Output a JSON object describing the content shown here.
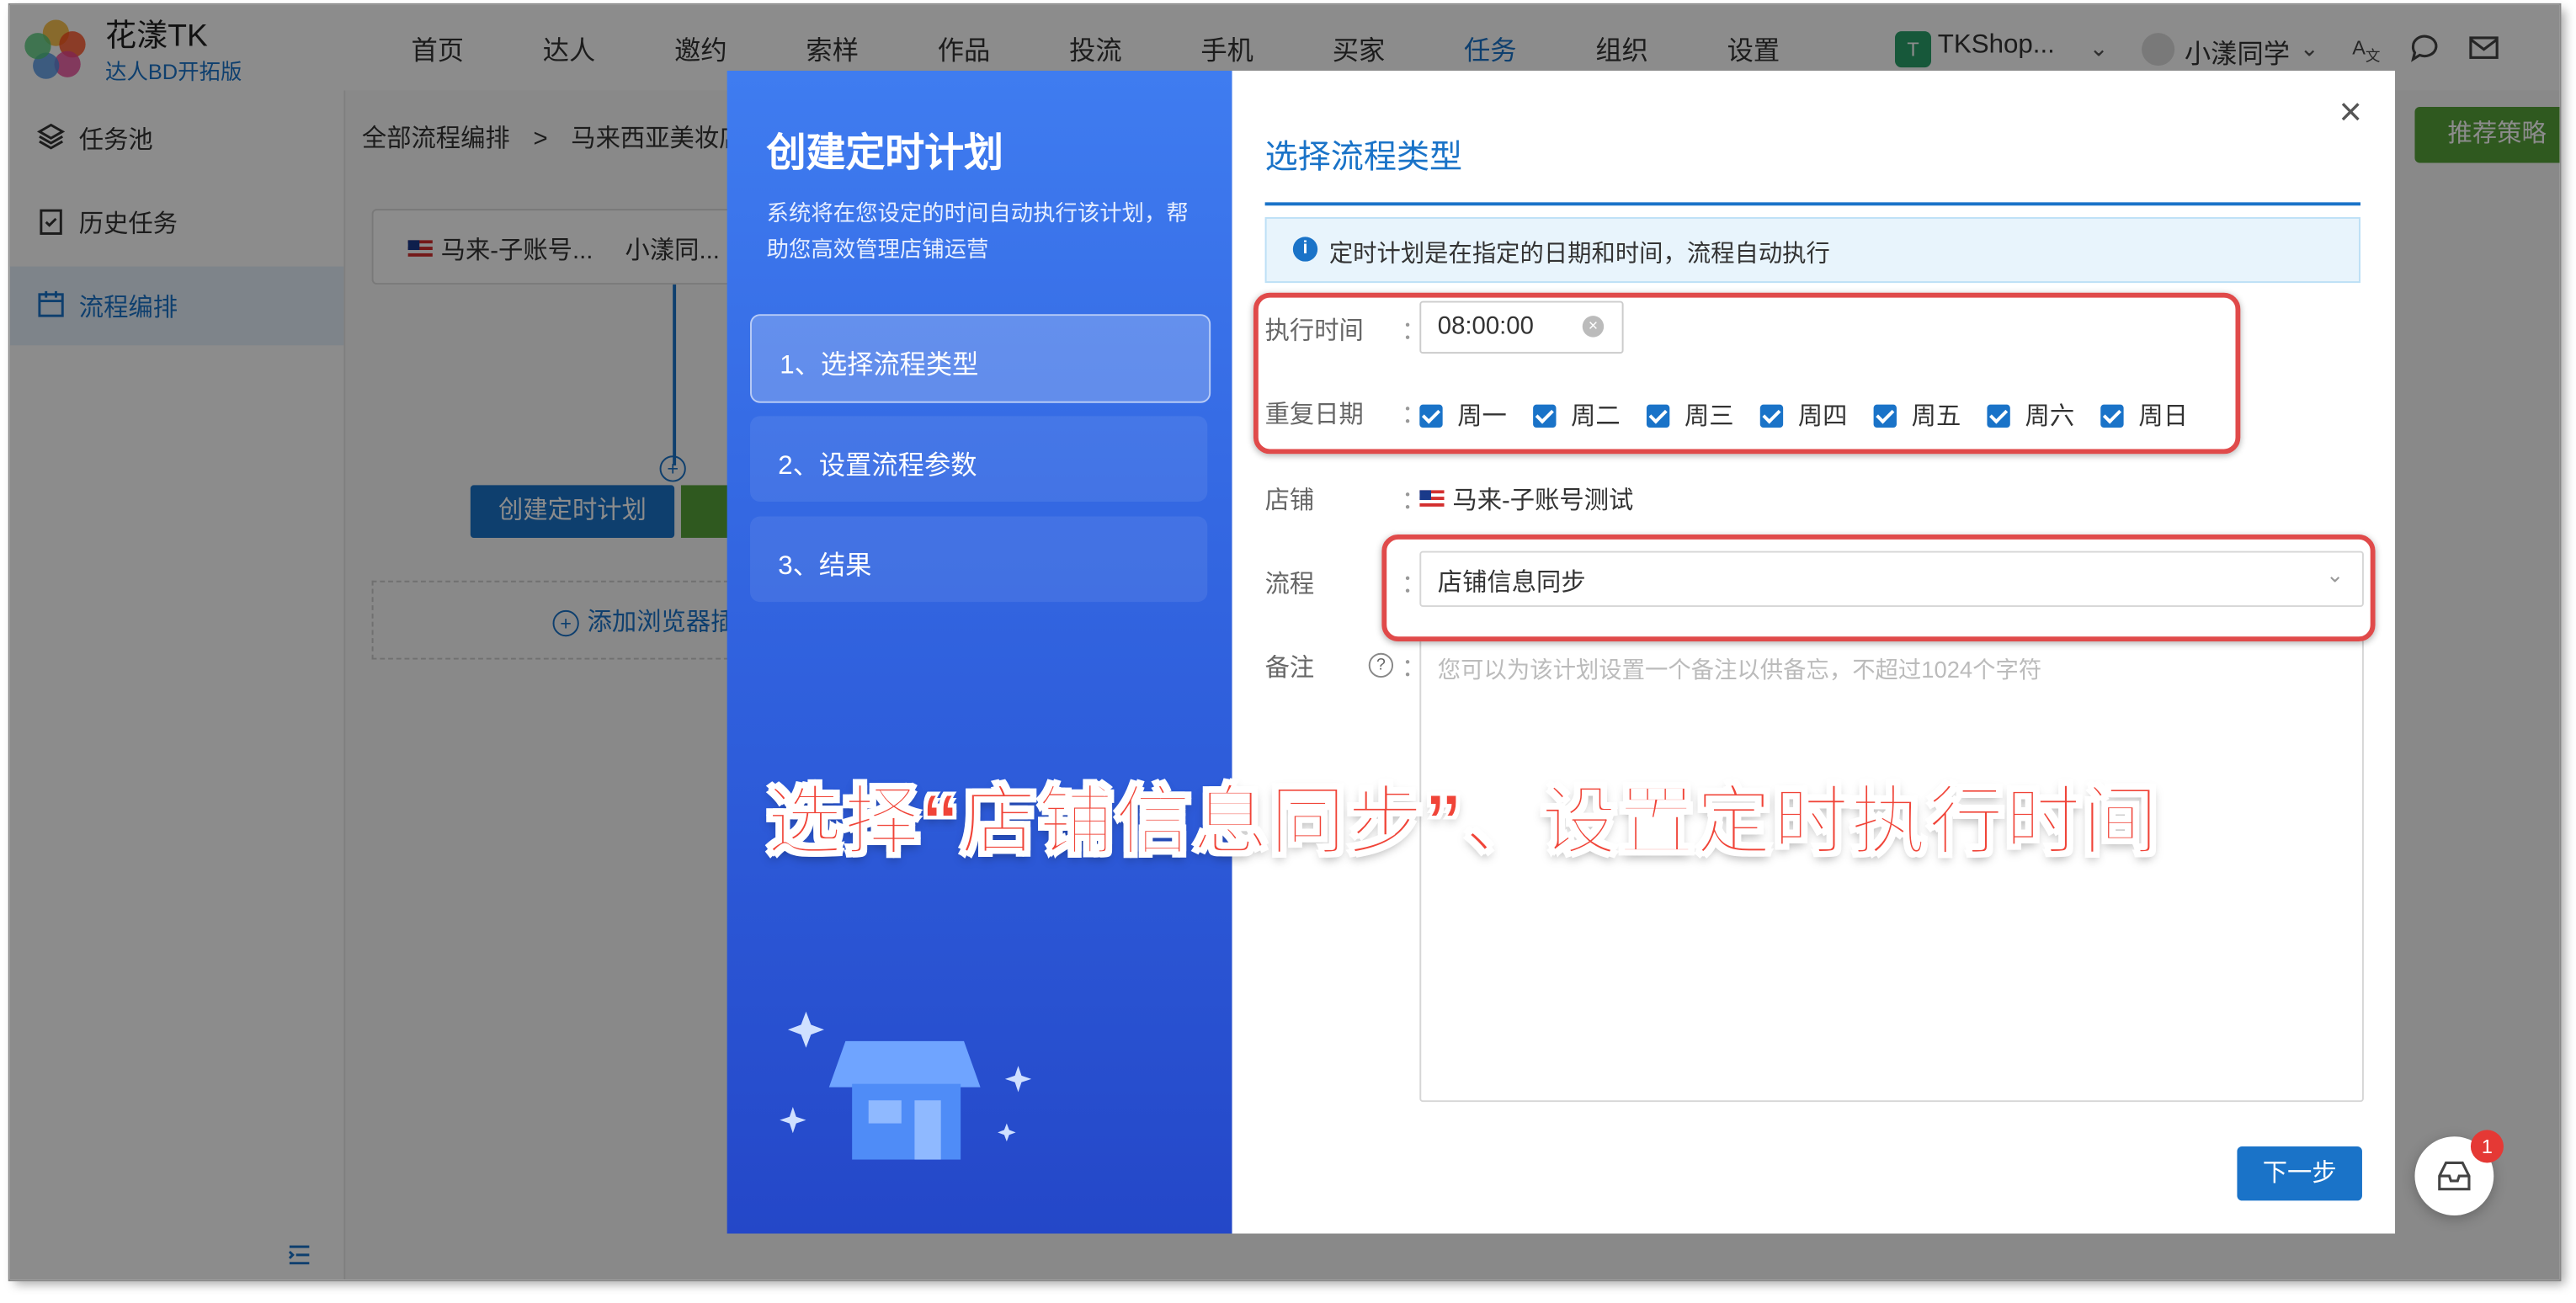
{
  "header": {
    "brand_title": "花漾TK",
    "brand_subtitle": "达人BD开拓版",
    "nav": [
      "首页",
      "达人",
      "邀约",
      "索样",
      "作品",
      "投流",
      "手机",
      "买家",
      "任务",
      "组织",
      "设置"
    ],
    "active_nav": "任务",
    "shop_badge": "T",
    "shop_name": "TKShop...",
    "user_name": "小漾同学"
  },
  "sidebar": {
    "items": [
      {
        "label": "任务池",
        "icon": "layers-icon"
      },
      {
        "label": "历史任务",
        "icon": "clipboard-icon"
      },
      {
        "label": "流程编排",
        "icon": "calendar-icon"
      }
    ],
    "active": "流程编排"
  },
  "main": {
    "breadcrumb_root": "全部流程编排",
    "breadcrumb_sep": ">",
    "breadcrumb_current": "马来西亚美妆店",
    "recommend_button": "推荐策略",
    "account_1": "马来-子账号...",
    "account_2": "小漾同...",
    "create_plan_button": "创建定时计划",
    "add_extension": "添加浏览器插"
  },
  "modal": {
    "left": {
      "title": "创建定时计划",
      "description": "系统将在您设定的时间自动执行该计划，帮助您高效管理店铺运营",
      "steps": [
        "1、选择流程类型",
        "2、设置流程参数",
        "3、结果"
      ],
      "active_step": 0
    },
    "right": {
      "title": "选择流程类型",
      "info": "定时计划是在指定的日期和时间，流程自动执行",
      "exec_time_label": "执行时间",
      "exec_time_value": "08:00:00",
      "repeat_label": "重复日期",
      "days": [
        "周一",
        "周二",
        "周三",
        "周四",
        "周五",
        "周六",
        "周日"
      ],
      "days_checked": [
        true,
        true,
        true,
        true,
        true,
        true,
        true
      ],
      "shop_label": "店铺",
      "shop_value": "马来-子账号测试",
      "flow_label": "流程",
      "flow_value": "店铺信息同步",
      "note_label": "备注",
      "note_placeholder": "您可以为该计划设置一个备注以供备忘，不超过1024个字符",
      "next_button": "下一步",
      "colon": "："
    }
  },
  "annotation": {
    "caption": "选择“店铺信息同步”、设置定时执行时间",
    "color": "#f04438"
  },
  "inbox": {
    "badge": "1"
  },
  "colors": {
    "primary": "#1a73c8",
    "green": "#57a33a",
    "modal_gradient_top": "#3f7cf0",
    "modal_gradient_bottom": "#2447c8"
  }
}
